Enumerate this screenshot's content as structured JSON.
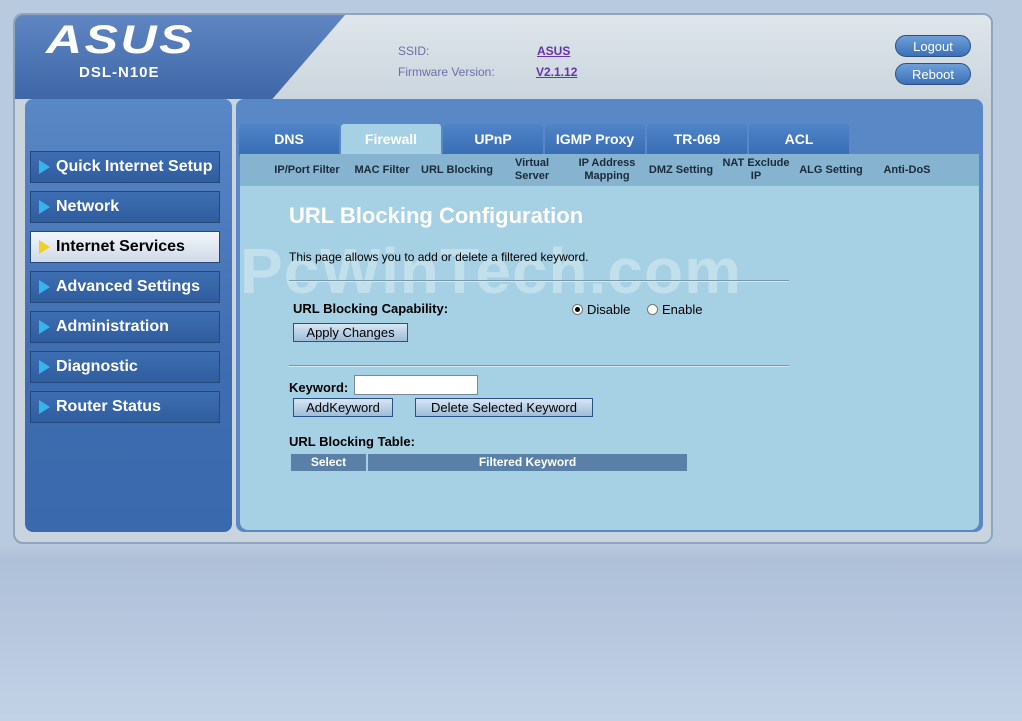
{
  "header": {
    "brand": "ASUS",
    "model": "DSL-N10E",
    "ssid_label": "SSID:",
    "ssid_value": "ASUS",
    "firmware_label": "Firmware Version:",
    "firmware_value": "V2.1.12",
    "logout_label": "Logout",
    "reboot_label": "Reboot"
  },
  "sidebar": {
    "items": [
      {
        "label": "Quick Internet Setup"
      },
      {
        "label": "Network"
      },
      {
        "label": "Internet Services"
      },
      {
        "label": "Advanced Settings"
      },
      {
        "label": "Administration"
      },
      {
        "label": "Diagnostic"
      },
      {
        "label": "Router Status"
      }
    ]
  },
  "tabs": [
    {
      "label": "DNS"
    },
    {
      "label": "Firewall"
    },
    {
      "label": "UPnP"
    },
    {
      "label": "IGMP Proxy"
    },
    {
      "label": "TR-069"
    },
    {
      "label": "ACL"
    }
  ],
  "subtabs": [
    {
      "label": "IP/Port Filter"
    },
    {
      "label": "MAC Filter"
    },
    {
      "label": "URL Blocking"
    },
    {
      "label": "Virtual Server"
    },
    {
      "label": "IP Address Mapping"
    },
    {
      "label": "DMZ Setting"
    },
    {
      "label": "NAT Exclude IP"
    },
    {
      "label": "ALG Setting"
    },
    {
      "label": "Anti-DoS"
    }
  ],
  "watermark": "PcWinTech.com",
  "main": {
    "title": "URL Blocking Configuration",
    "description": "This page allows you to add or delete a filtered keyword.",
    "capability_label": "URL Blocking Capability:",
    "radio_disable": "Disable",
    "radio_enable": "Enable",
    "selected": "Disable",
    "apply_button": "Apply Changes",
    "keyword_label": "Keyword:",
    "keyword_value": "",
    "add_button": "AddKeyword",
    "delete_button": "Delete Selected Keyword",
    "table_label": "URL Blocking Table:",
    "table_headers": [
      "Select",
      "Filtered Keyword"
    ]
  }
}
